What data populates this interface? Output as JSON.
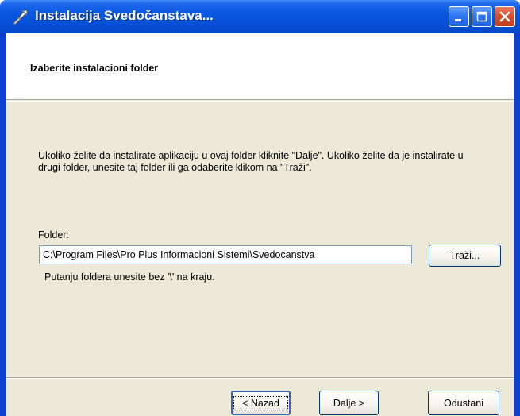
{
  "window": {
    "title": "Instalacija Svedočanstava...",
    "controls": [
      "minimize-icon",
      "maximize-icon",
      "close-icon"
    ]
  },
  "header": {
    "title": "Izaberite instalacioni folder"
  },
  "content": {
    "description": "Ukoliko želite da instalirate aplikaciju u ovaj folder kliknite \"Dalje\". Ukoliko želite da je instalirate u drugi folder, unesite taj folder ili ga odaberite klikom na \"Traži\".",
    "folder_label": "Folder:",
    "folder_value": "C:\\Program Files\\Pro Plus Informacioni Sistemi\\Svedocanstva",
    "browse_label": "Traži...",
    "hint": "Putanju foldera unesite bez '\\' na kraju."
  },
  "footer": {
    "back_label": "< Nazad",
    "next_label": "Dalje >",
    "cancel_label": "Odustani"
  },
  "colors": {
    "titlebar": "#0a57e0",
    "dialog_bg": "#ece9d8",
    "close_button": "#d5502e"
  }
}
